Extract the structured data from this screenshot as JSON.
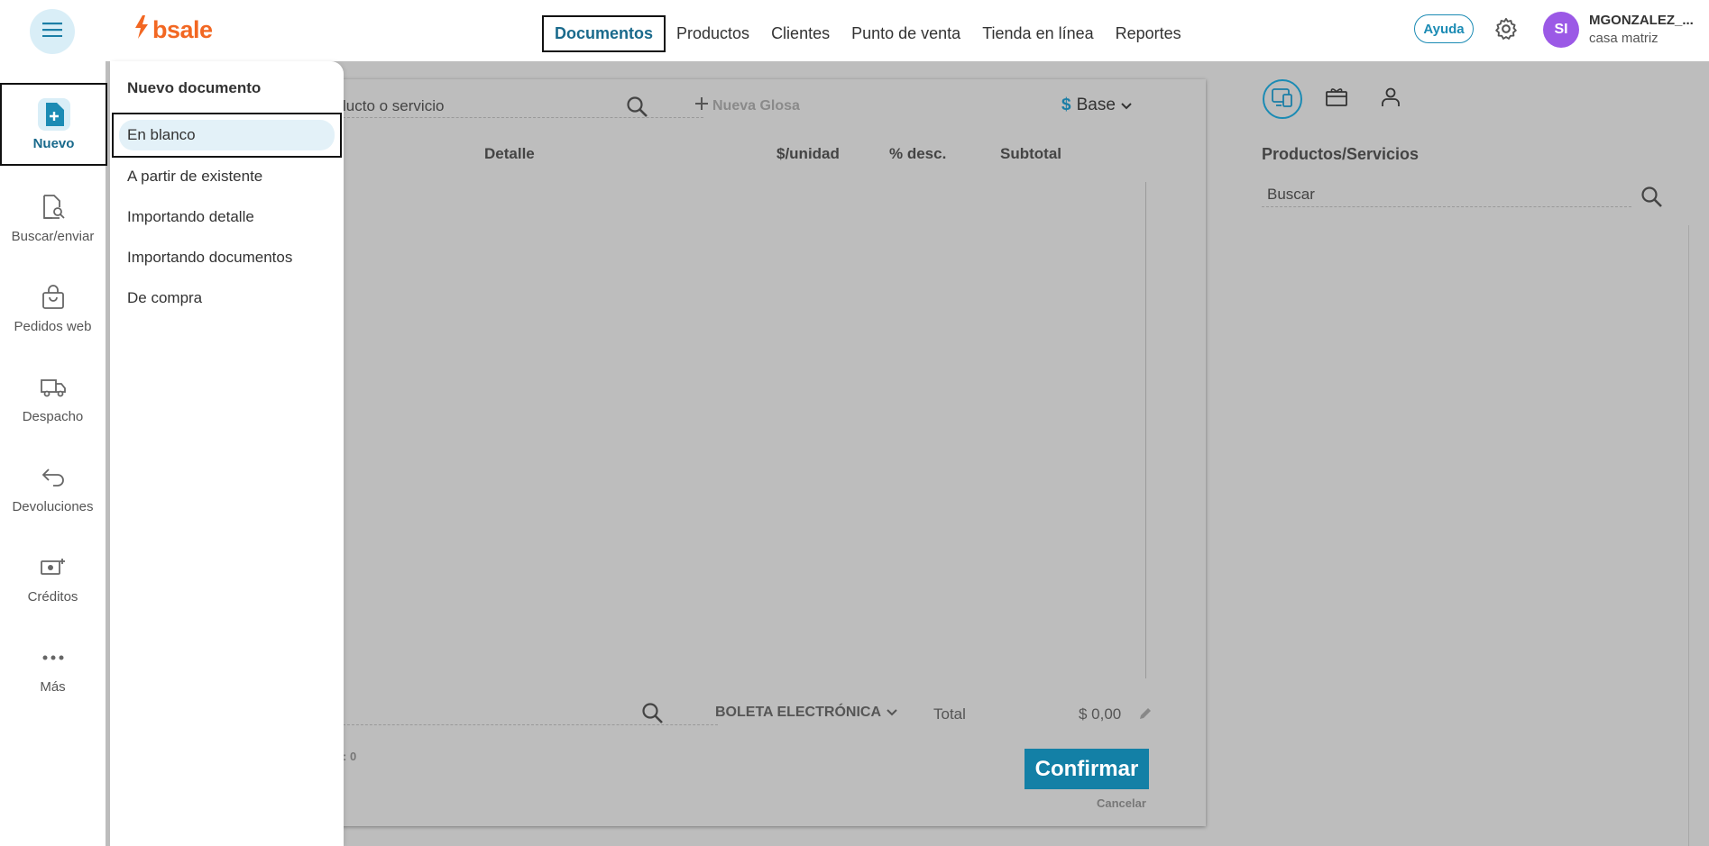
{
  "header": {
    "logo_text": "bsale",
    "nav": [
      "Documentos",
      "Productos",
      "Clientes",
      "Punto de venta",
      "Tienda en línea",
      "Reportes"
    ],
    "help_label": "Ayuda",
    "avatar_initials": "SI",
    "user_name": "MGONZALEZ_...",
    "branch": "casa matriz"
  },
  "sidebar": {
    "items": [
      {
        "label": "Nuevo",
        "icon": "new-document-icon"
      },
      {
        "label": "Buscar/enviar",
        "icon": "search-document-icon"
      },
      {
        "label": "Pedidos web",
        "icon": "shopping-bag-icon"
      },
      {
        "label": "Despacho",
        "icon": "truck-icon"
      },
      {
        "label": "Devoluciones",
        "icon": "return-arrow-icon"
      },
      {
        "label": "Créditos",
        "icon": "cash-plus-icon"
      },
      {
        "label": "Más",
        "icon": "more-dots-icon"
      }
    ]
  },
  "dropdown": {
    "heading": "Nuevo documento",
    "items": [
      "En blanco",
      "A partir de existente",
      "Importando detalle",
      "Importando documentos",
      "De compra"
    ]
  },
  "document": {
    "search_placeholder_visible": "lucto o servicio",
    "new_glosa": "Nueva Glosa",
    "currency_symbol": "$",
    "price_list": "Base",
    "columns": [
      "Detalle",
      "$/unidad",
      "% desc.",
      "Subtotal"
    ],
    "doc_type": "BOLETA ELECTRÓNICA",
    "total_label": "Total",
    "total_value": "$ 0,00",
    "items_count_visible": ": 0",
    "confirm_label": "Confirmar",
    "cancel_label": "Cancelar"
  },
  "right_panel": {
    "title": "Productos/Servicios",
    "search_placeholder": "Buscar"
  },
  "colors": {
    "accent": "#1380a6",
    "brand": "#f26722",
    "avatar": "#9b59e6",
    "overlay": "#bdbdbd"
  }
}
